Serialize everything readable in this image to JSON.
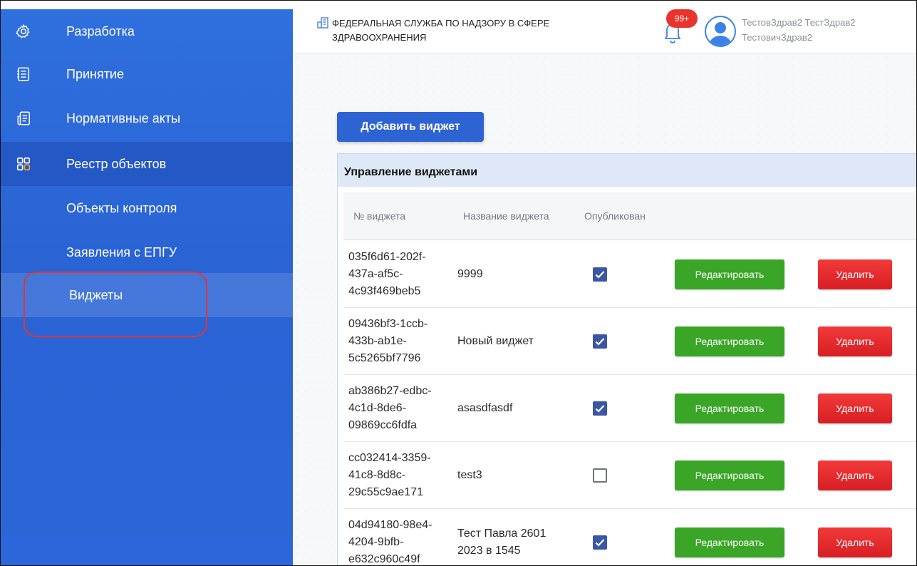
{
  "sidebar": {
    "items": [
      {
        "label": "Разработка",
        "icon": "gear-icon"
      },
      {
        "label": "Принятие",
        "icon": "checklist-icon"
      },
      {
        "label": "Нормативные акты",
        "icon": "document-icon"
      },
      {
        "label": "Реестр объектов",
        "icon": "grid-icon"
      }
    ],
    "subitems": [
      {
        "label": "Объекты контроля"
      },
      {
        "label": "Заявления с ЕПГУ"
      },
      {
        "label": "Виджеты"
      }
    ]
  },
  "header": {
    "org_name": "ФЕДЕРАЛЬНАЯ СЛУЖБА ПО НАДЗОРУ В СФЕРЕ ЗДРАВООХРАНЕНИЯ",
    "notifications_badge": "99+",
    "user_line1": "ТестовЗдрав2 ТестЗдрав2",
    "user_line2": "ТестовичЗдрав2"
  },
  "main": {
    "add_button": "Добавить виджет",
    "panel_title": "Управление виджетами",
    "columns": [
      "№ виджета",
      "Название виджета",
      "Опубликован"
    ],
    "edit_label": "Редактировать",
    "delete_label": "Удалить",
    "rows": [
      {
        "id": "035f6d61-202f-\n437a-af5c-\n4c93f469beb5",
        "name": "9999",
        "published": true
      },
      {
        "id": "09436bf3-1ccb-\n433b-ab1e-\n5c5265bf7796",
        "name": "Новый виджет",
        "published": true
      },
      {
        "id": "ab386b27-edbc-\n4c1d-8de6-\n09869cc6fdfa",
        "name": "asasdfasdf",
        "published": true
      },
      {
        "id": "cc032414-3359-\n41c8-8d8c-\n29c55c9ae171",
        "name": "test3",
        "published": false
      },
      {
        "id": "04d94180-98e4-\n4204-9bfb-\ne632c960c49f",
        "name": "Тест Павла 2601 2023 в 1545",
        "published": true
      }
    ]
  },
  "colors": {
    "sidebar": "#2f6fde",
    "primary_button": "#2d63d3",
    "edit_button": "#3aa526",
    "delete_button": "#e02a2d",
    "badge": "#e8342c",
    "highlight_ring": "#e0353a"
  }
}
